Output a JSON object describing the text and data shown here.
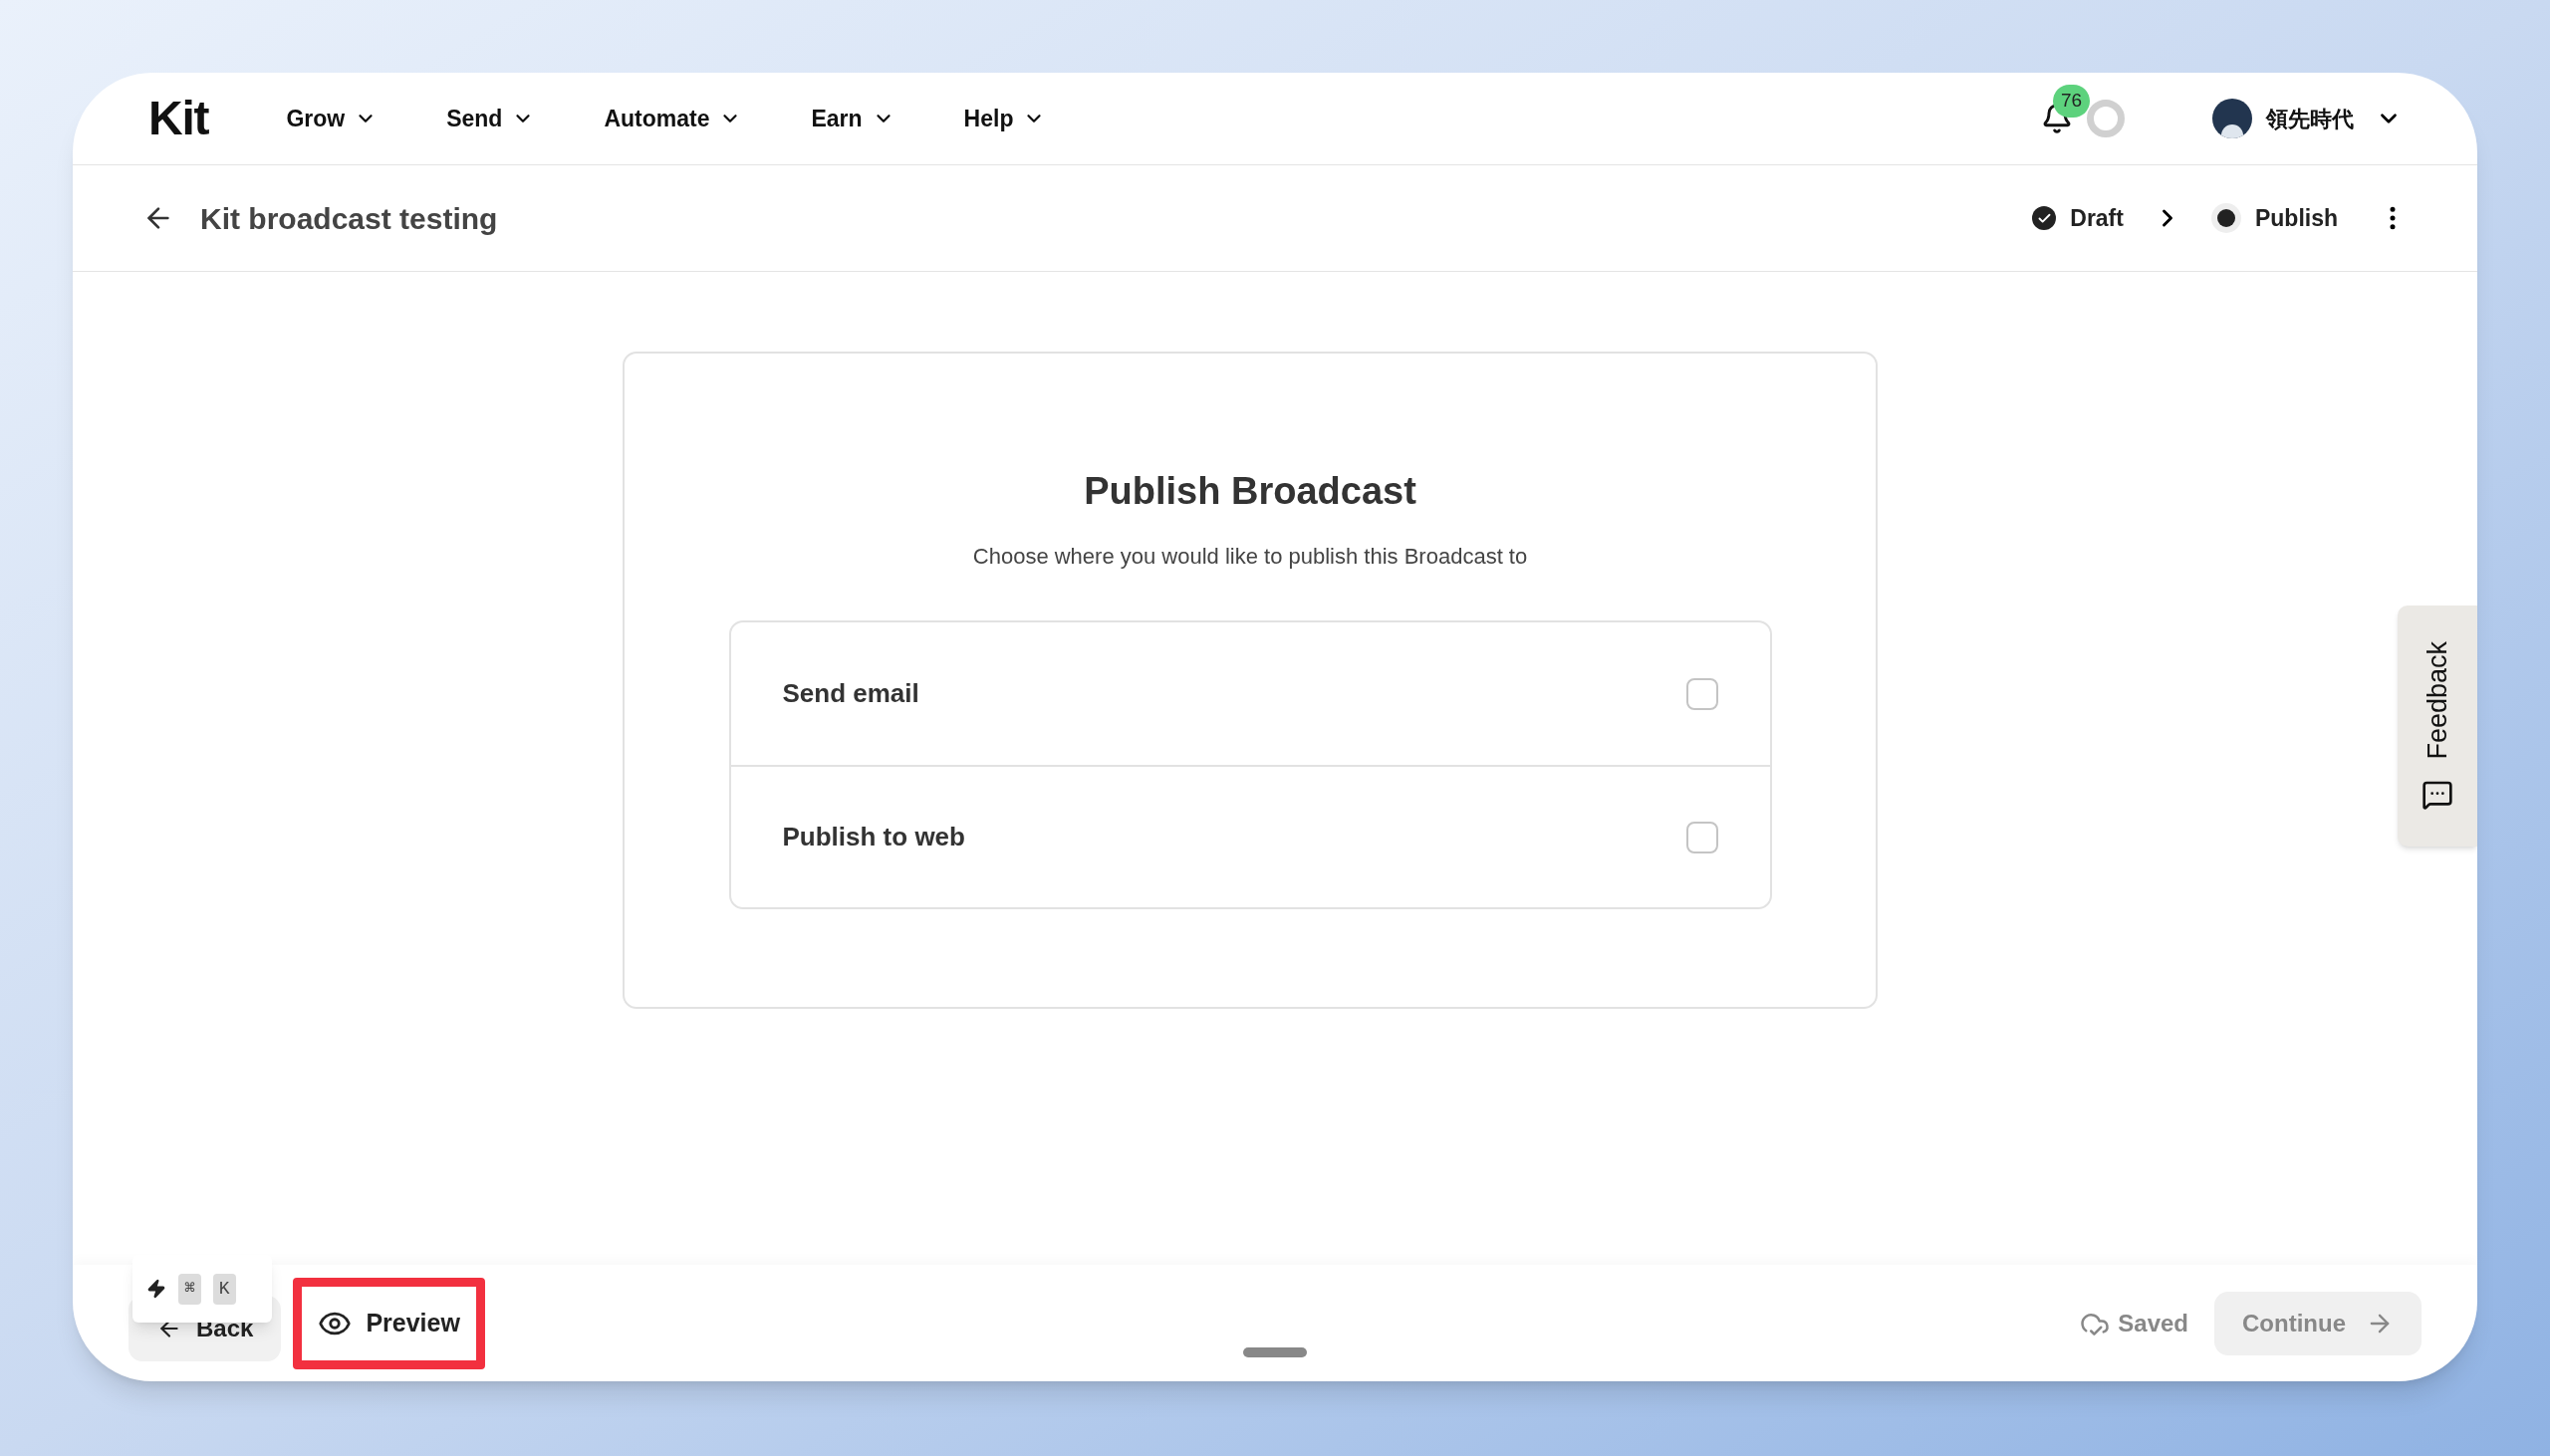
{
  "nav": {
    "logo": "Kit",
    "items": [
      {
        "label": "Grow"
      },
      {
        "label": "Send"
      },
      {
        "label": "Automate"
      },
      {
        "label": "Earn"
      },
      {
        "label": "Help"
      }
    ],
    "notifications": {
      "count": "76"
    },
    "user": {
      "name": "領先時代"
    }
  },
  "header": {
    "title": "Kit broadcast testing",
    "steps": [
      {
        "label": "Draft",
        "done": true
      },
      {
        "label": "Publish",
        "done": false
      }
    ]
  },
  "card": {
    "title": "Publish Broadcast",
    "subtitle": "Choose where you would like to publish this Broadcast to",
    "options": [
      {
        "label": "Send email",
        "checked": false
      },
      {
        "label": "Publish to web",
        "checked": false
      }
    ]
  },
  "feedback": {
    "label": "Feedback"
  },
  "footer": {
    "back": "Back",
    "shortcut_keys": [
      "⌘",
      "K"
    ],
    "preview": {
      "label": "Preview",
      "highlighted": true
    },
    "status": "Saved",
    "continue": {
      "label": "Continue",
      "disabled": true
    }
  }
}
